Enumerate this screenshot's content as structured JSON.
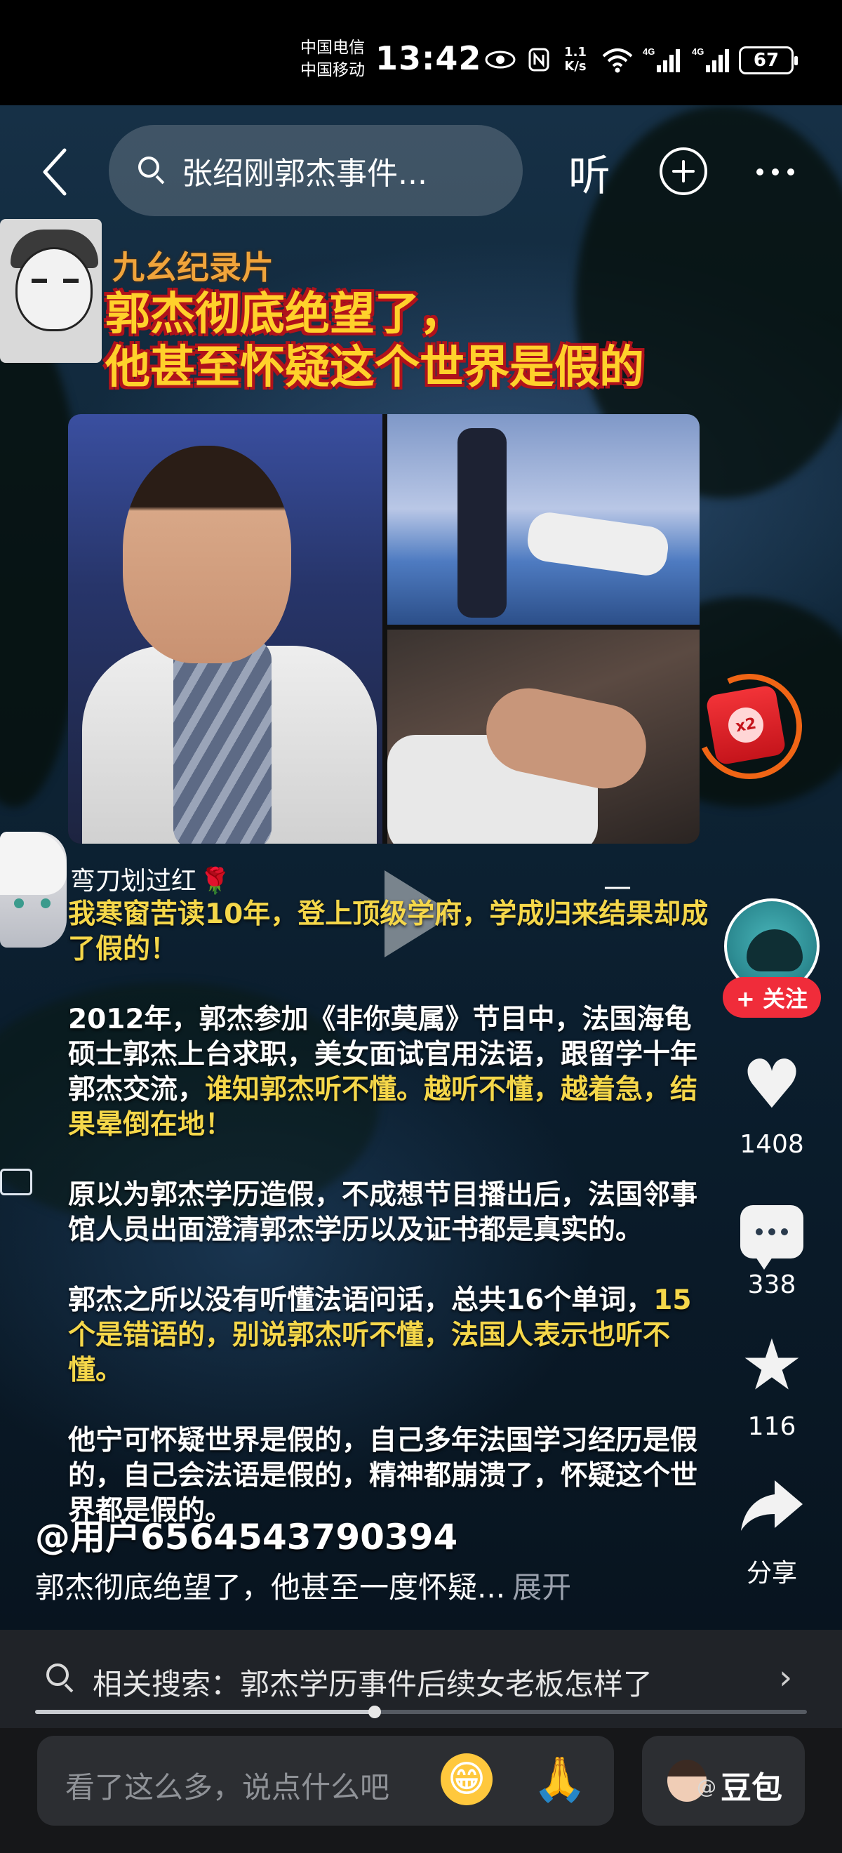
{
  "status_bar": {
    "carrier_1": "中国电信",
    "carrier_2": "中国移动",
    "time": "13:42",
    "net_speed_value": "1.1",
    "net_speed_unit": "K/s",
    "network_1": "4G",
    "network_2": "4G",
    "battery": "67"
  },
  "top_nav": {
    "search_text": "张绍刚郭杰事件...",
    "listen_label": "听"
  },
  "video": {
    "channel": "九幺纪录片",
    "headline_line1": "郭杰彻底绝望了，",
    "headline_line2": "他甚至怀疑这个世界是假的",
    "red_packet_multiplier": "x2",
    "comment_author": "弯刀划过红",
    "comment_author_emoji": "🌹",
    "paragraphs": [
      {
        "white": "",
        "yellow": "我寒窗苦读10年，登上顶级学府，学成归来结果却成了假的！"
      },
      {
        "white": "2012年，郭杰参加《非你莫属》节目中，法国海龟硕士郭杰上台求职，美女面试官用法语，跟留学十年郭杰交流，",
        "yellow": "谁知郭杰听不懂。越听不懂，越着急，结果晕倒在地！"
      },
      {
        "white": "原以为郭杰学历造假，不成想节目播出后，法国邻事馆人员出面澄清郭杰学历以及证书都是真实的。",
        "yellow": ""
      },
      {
        "white": "郭杰之所以没有听懂法语问话，总共16个单词，",
        "yellow": "15个是错语的，别说郭杰听不懂，法国人表示也听不懂。"
      },
      {
        "white": "他宁可怀疑世界是假的，自己多年法国学习经历是假的，自己会法语是假的，精神都崩溃了，怀疑这个世界都是假的。",
        "yellow": ""
      }
    ]
  },
  "actions": {
    "follow_label": "+ 关注",
    "likes": "1408",
    "comments": "338",
    "favorites": "116",
    "share_label": "分享"
  },
  "caption": {
    "username": "@用户6564543790394",
    "text": "郭杰彻底绝望了，他甚至一度怀疑...",
    "expand_label": "展开"
  },
  "related_search": {
    "label": "相关搜索：郭杰学历事件后续女老板怎样了"
  },
  "progress": {
    "fraction": 0.44
  },
  "bottom_bar": {
    "comment_placeholder": "看了这么多，说点什么吧",
    "emoji_1": "😁",
    "emoji_2": "🙏",
    "assistant_label": "豆包"
  },
  "icons": [
    "back-icon",
    "search-icon",
    "plus-icon",
    "more-icon",
    "heart-icon",
    "comment-icon",
    "star-icon",
    "share-icon",
    "chevron-right-icon"
  ]
}
